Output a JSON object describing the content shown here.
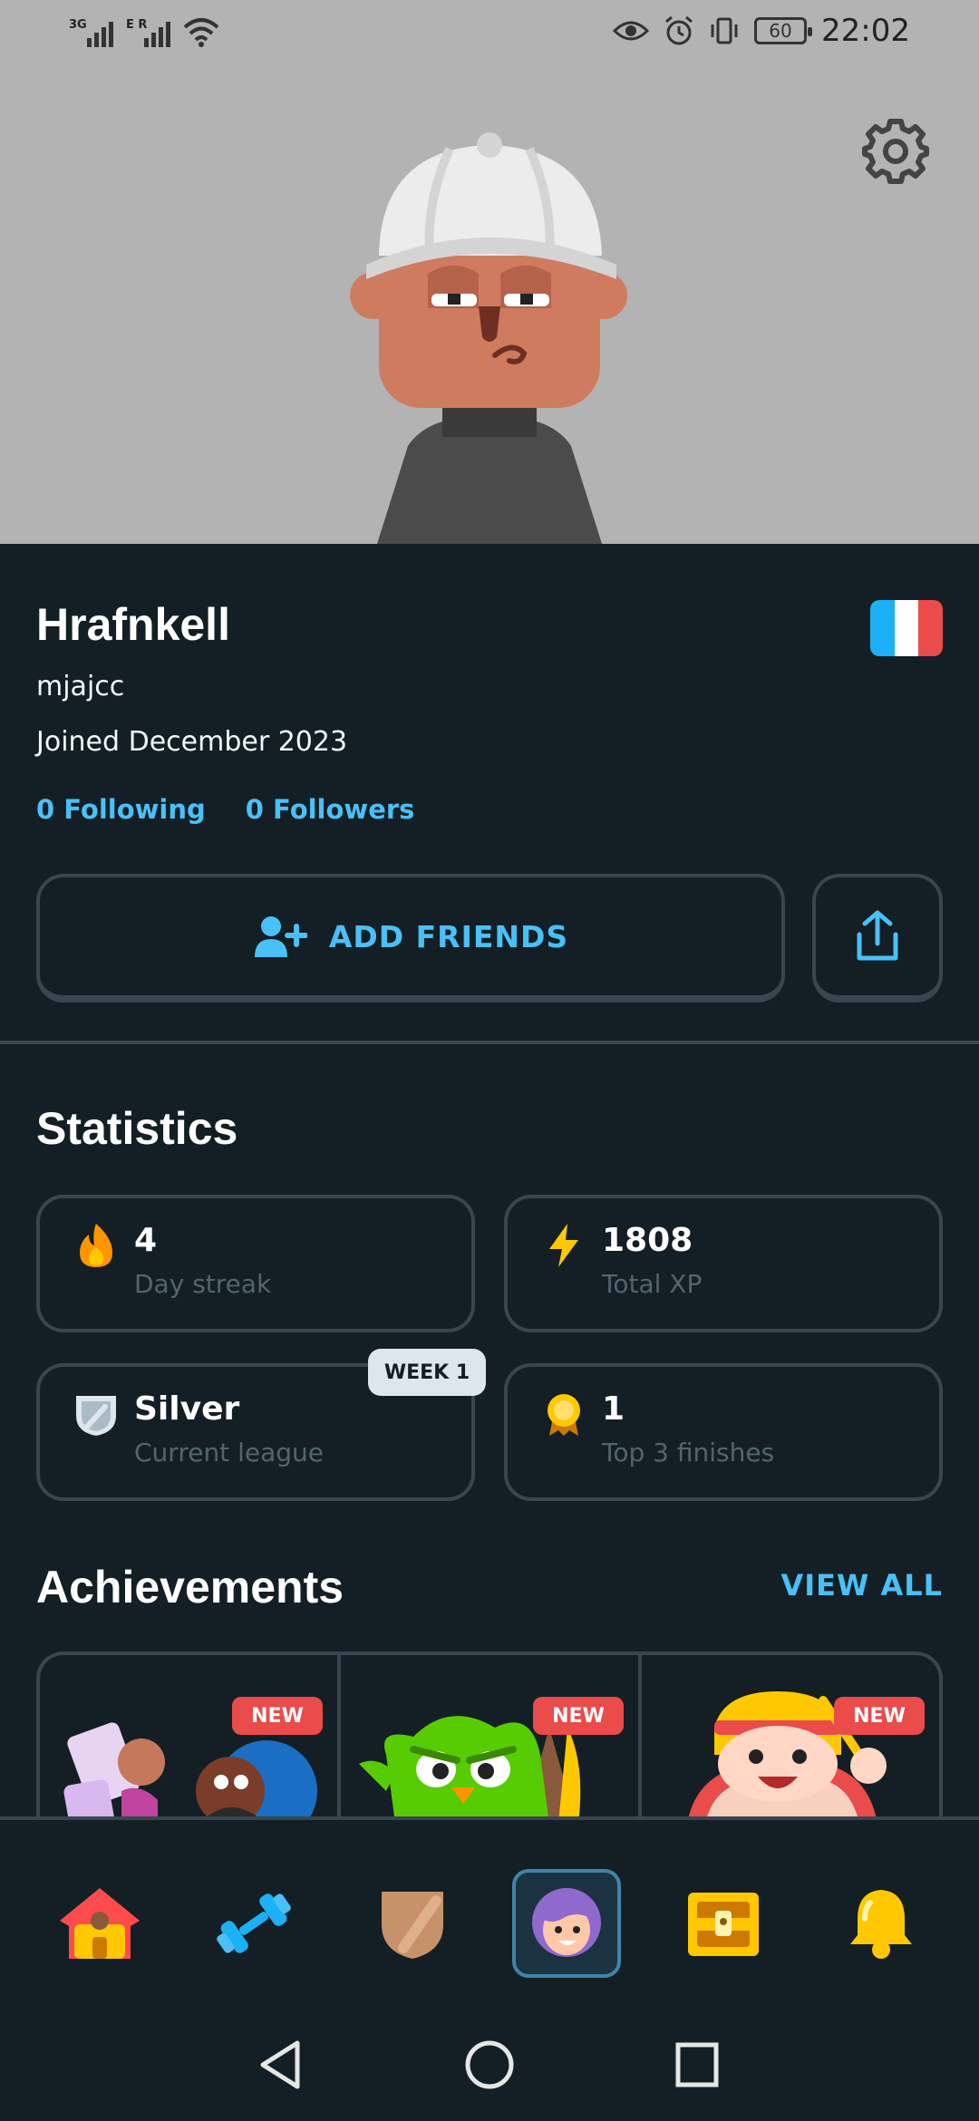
{
  "status_bar": {
    "signal1_tag": "3G",
    "signal2_tag": "E R",
    "battery": "60",
    "time": "22:02"
  },
  "profile": {
    "display_name": "Hrafnkell",
    "username": "mjajcc",
    "joined": "Joined December 2023",
    "following": "0 Following",
    "followers": "0 Followers",
    "flag_colors": [
      "#1cb0f6",
      "#ffffff",
      "#ea4b4b"
    ]
  },
  "actions": {
    "add_friends": "ADD FRIENDS"
  },
  "statistics": {
    "title": "Statistics",
    "cards": [
      {
        "value": "4",
        "label": "Day streak",
        "icon": "fire-icon"
      },
      {
        "value": "1808",
        "label": "Total XP",
        "icon": "lightning-icon"
      },
      {
        "value": "Silver",
        "label": "Current league",
        "icon": "silver-league-icon",
        "badge": "WEEK 1"
      },
      {
        "value": "1",
        "label": "Top 3 finishes",
        "icon": "medal-icon"
      }
    ]
  },
  "achievements": {
    "title": "Achievements",
    "view_all": "VIEW ALL",
    "items": [
      {
        "badge": "NEW"
      },
      {
        "badge": "NEW"
      },
      {
        "badge": "NEW"
      }
    ]
  },
  "nav": [
    "home-icon",
    "practice-dumbbell-icon",
    "league-shield-icon",
    "profile-icon",
    "shop-chest-icon",
    "notifications-bell-icon"
  ],
  "colors": {
    "background": "#131f24",
    "accent_blue": "#49c0f8",
    "border": "#37464f",
    "muted_text": "#52656d",
    "new_badge": "#ea4b4b"
  }
}
